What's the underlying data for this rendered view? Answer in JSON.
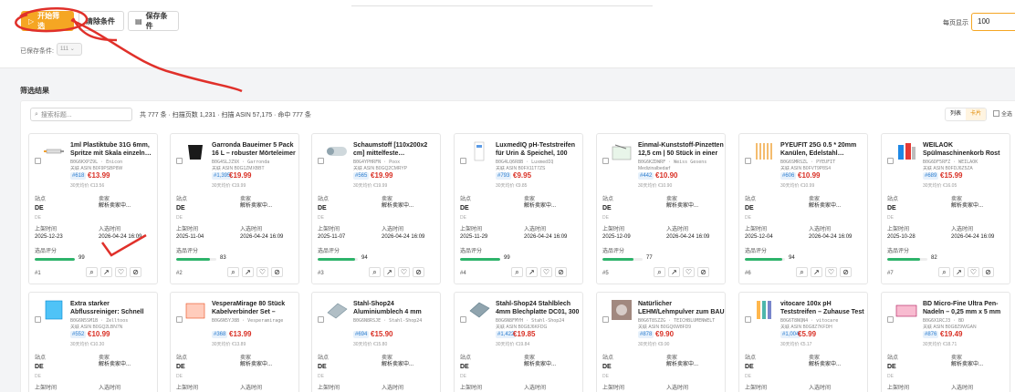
{
  "toolbar": {
    "start_label": "开始筛选",
    "clear_label": "清除条件",
    "save_label": "保存条件",
    "per_page_label": "每页显示",
    "per_page_value": "100",
    "saved_label": "已保存条件:",
    "saved_value": "111"
  },
  "results": {
    "title": "筛选结果",
    "search_placeholder": "搜索标题...",
    "stats": "共 777 条 · 扫描页数 1,231 · 扫描 ASIN 57,175 · 命中 777 条",
    "view_list": "列表",
    "view_card": "卡片",
    "select_all": "全选"
  },
  "labels": {
    "site": "站点",
    "seller": "卖家",
    "listed": "上架时间",
    "entered": "入选时间",
    "score": "选品评分",
    "asin_prefix": "关联"
  },
  "colors": {
    "accent": "#f5a623",
    "price": "#d93025",
    "score": "#2db36a",
    "annotation": "#e0302a"
  },
  "cards": [
    {
      "title": "1ml Plastiktube 31G 6mm, Spritze mit Skala einzeln…",
      "sku": "B0G6KXPZ9L · Enicon",
      "asin": "关联 ASIN B0F9PSBP8W",
      "rank": "#618",
      "price": "€13.99",
      "avg": "30天均价 €13.56",
      "site": "DE",
      "site_sub": "DE",
      "seller": "解析卖家中...",
      "listed": "2025-12-23",
      "entered": "2026-04-24 16:09",
      "score": 99,
      "score_text": "99",
      "index": "#1",
      "thumb_icon": "syringe-icon"
    },
    {
      "title": "Garronda Baueimer 5 Pack 16 L – robuster Mörteleimer aus…",
      "sku": "B0G4SLJZ9X · Garronda",
      "asin": "关联 ASIN B0G1ZMXBBT",
      "rank": "#1,395",
      "price": "€19.99",
      "avg": "30天均价 €19.99",
      "site": "DE",
      "site_sub": "DE",
      "seller": "解析卖家中...",
      "listed": "2025-11-04",
      "entered": "2026-04-24 16:09",
      "score": 83,
      "score_text": "83",
      "index": "#2",
      "thumb_icon": "bucket-icon"
    },
    {
      "title": "Schaumstoff [110x200x2 cm] mittelfeste…",
      "sku": "B0G4YPHRFN · Poox",
      "asin": "关联 ASIN B0GQ2CMRYP",
      "rank": "#565",
      "price": "€19.99",
      "avg": "30天均价 €19.99",
      "site": "DE",
      "site_sub": "DE",
      "seller": "解析卖家中...",
      "listed": "2025-11-07",
      "entered": "2026-04-24 16:09",
      "score": 94,
      "score_text": "94",
      "index": "#3",
      "thumb_icon": "foam-roll-icon"
    },
    {
      "title": "LuxmedIQ pH-Teststreifen für Urin & Speichel, 100 Stück –…",
      "sku": "B0G4LQ6R8B · LuxmedIQ",
      "asin": "关联 ASIN B0FX11T7ZS",
      "rank": "#793",
      "price": "€9.95",
      "avg": "30天均价 €9.85",
      "site": "DE",
      "site_sub": "DE",
      "seller": "解析卖家中...",
      "listed": "2025-11-29",
      "entered": "2026-04-24 16:09",
      "score": 99,
      "score_text": "99",
      "index": "#4",
      "thumb_icon": "test-strip-icon"
    },
    {
      "title": "Einmal-Kunststoff-Pinzetten 12,5 cm | 50 Stück in einer Box -…",
      "sku": "B0G6KZDWRF · Weiss Gesens",
      "asin": "Medizinalbedarf",
      "rank": "#442",
      "price": "€10.90",
      "avg": "30天均价 €10.90",
      "site": "DE",
      "site_sub": "DE",
      "seller": "解析卖家中...",
      "listed": "2025-12-09",
      "entered": "2026-04-24 16:09",
      "score": 77,
      "score_text": "77",
      "index": "#5",
      "thumb_icon": "tweezer-box-icon"
    },
    {
      "title": "PYEUFIT 25G 0.5 * 20mm Kanülen, Edelstahl…",
      "sku": "B0G6SMRSZL · PYEUFIT",
      "asin": "关联 ASIN B0FVT9P8S4",
      "rank": "#606",
      "price": "€10.99",
      "avg": "30天均价 €10.99",
      "site": "DE",
      "site_sub": "DE",
      "seller": "解析卖家中...",
      "listed": "2025-12-04",
      "entered": "2026-04-24 16:09",
      "score": 94,
      "score_text": "94",
      "index": "#6",
      "thumb_icon": "needles-icon"
    },
    {
      "title": "WEILAOK Spülmaschinenkorb Rost Reparatur, Geschirrspüler…",
      "sku": "B0G6DF5RFZ · WEILAOK",
      "asin": "关联 ASIN B0FDJ6Z5ZA",
      "rank": "#689",
      "price": "€15.99",
      "avg": "30天均价 €16.05",
      "site": "DE",
      "site_sub": "DE",
      "seller": "解析卖家中...",
      "listed": "2025-10-28",
      "entered": "2026-04-24 16:09",
      "score": 82,
      "score_text": "82",
      "index": "#7",
      "thumb_icon": "repair-tube-icon"
    },
    {
      "title": "Extra starker Abflussreiniger: Schnell wirkendes Rohrreinige…",
      "sku": "B0G6N5SM1B · Zelltoos",
      "asin": "关联 ASIN B0GQ2LBN7N",
      "rank": "#552",
      "price": "€10.99",
      "avg": "30天均价 €10.30",
      "site": "DE",
      "site_sub": "DE",
      "seller": "解析卖家中...",
      "listed": "",
      "entered": "",
      "score": 0,
      "score_text": "",
      "index": "",
      "thumb_icon": "cleaner-box-icon"
    },
    {
      "title": "VesperaMirage 80 Stück Kabelverbinder Set – Hebel-…",
      "sku": "B0G6N5YJ8B · Vesperamirage",
      "asin": "",
      "rank": "#368",
      "price": "€13.99",
      "avg": "30天均价 €13.89",
      "site": "DE",
      "site_sub": "DE",
      "seller": "解析卖家中...",
      "listed": "2025-12-26",
      "entered": "2026-04-24 16:09",
      "score": 0,
      "score_text": "",
      "index": "",
      "thumb_icon": "connector-set-icon"
    },
    {
      "title": "Stahl-Shop24 Aluminiumblech 4 mm Zuschnitt 200 x 300 mm –…",
      "sku": "B0G6N8RSJE · Stahl-Shop24",
      "asin": "",
      "rank": "#694",
      "price": "€15.90",
      "avg": "30天均价 €15.80",
      "site": "DE",
      "site_sub": "DE",
      "seller": "解析卖家中...",
      "listed": "",
      "entered": "",
      "score": 0,
      "score_text": "",
      "index": "",
      "thumb_icon": "metal-sheet-icon"
    },
    {
      "title": "Stahl-Shop24 Stahlblech 4mm Blechplatte DC01, 300 x 300m…",
      "sku": "B0G6N8FMYH · Stahl-Shop24",
      "asin": "关联 ASIN B0G8J6KFDG",
      "rank": "#1,422",
      "price": "€19.85",
      "avg": "30天均价 €19.84",
      "site": "DE",
      "site_sub": "DE",
      "seller": "解析卖家中...",
      "listed": "",
      "entered": "",
      "score": 0,
      "score_text": "",
      "index": "",
      "thumb_icon": "steel-plate-icon"
    },
    {
      "title": "Natürlicher LEHM/Lehmpulver zum BAU von SANDARIUM &…",
      "sku": "B0G6T8SZZG · TEICHBLUMENWELT",
      "asin": "关联 ASIN B0GQ6W8FD9",
      "rank": "#878",
      "price": "€9.90",
      "avg": "30天均价 €9.90",
      "site": "DE",
      "site_sub": "DE",
      "seller": "解析卖家中...",
      "listed": "",
      "entered": "",
      "score": 0,
      "score_text": "",
      "index": "",
      "thumb_icon": "clay-powder-icon"
    },
    {
      "title": "vitocare 100x pH Teststreifen – Zuhause Test für Säure und Ba…",
      "sku": "B0G6T8NQN4 · vitocare",
      "asin": "关联 ASIN B0G8Z7KFDH",
      "rank": "#1,004",
      "price": "€5.99",
      "avg": "30天均价 €5.17",
      "site": "DE",
      "site_sub": "DE",
      "seller": "解析卖家中...",
      "listed": "2026-01-28",
      "entered": "2026-04-24 16:09",
      "score": 0,
      "score_text": "",
      "index": "",
      "thumb_icon": "ph-strips-icon"
    },
    {
      "title": "BD Micro-Fine Ultra Pen-Nadeln – 0,25 mm x 5 mm (31G) – 100…",
      "sku": "B0G6X1RCJ3 · BD",
      "asin": "关联 ASIN B0G8Z9WGAN",
      "rank": "#876",
      "price": "€19.49",
      "avg": "30天均价 €18.71",
      "site": "DE",
      "site_sub": "DE",
      "seller": "解析卖家中...",
      "listed": "",
      "entered": "",
      "score": 0,
      "score_text": "",
      "index": "",
      "thumb_icon": "pen-needle-box-icon"
    }
  ]
}
